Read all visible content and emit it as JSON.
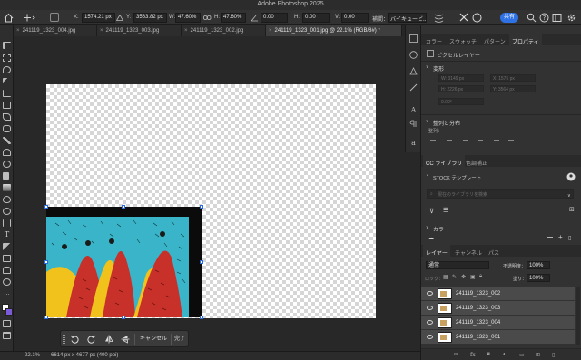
{
  "app": {
    "title": "Adobe Photoshop 2025"
  },
  "options_bar": {
    "x_label": "X:",
    "x_value": "1574.21 px",
    "y_label": "Y:",
    "y_value": "3563.82 px",
    "w_label": "W:",
    "w_value": "47.60%",
    "h_label": "H:",
    "h_value": "47.60%",
    "angle_value": "0.00",
    "h_skew_label": "H:",
    "h_skew_value": "0.00",
    "v_skew_label": "V:",
    "v_skew_value": "0.00",
    "interp_label": "補間：",
    "interp_value": "バイキュービ...",
    "share_label": "共有"
  },
  "tabs": [
    {
      "label": "241119_1323_004.jpg",
      "active": false
    },
    {
      "label": "241119_1323_003.jpg",
      "active": false
    },
    {
      "label": "241119_1323_002.jpg",
      "active": false
    },
    {
      "label": "241119_1323_001.jpg @ 22.1% (RGB/8#) *",
      "active": true
    }
  ],
  "tab_close_glyph": "×",
  "context_bar": {
    "cancel_label": "キャンセル",
    "done_label": "完了"
  },
  "status": {
    "zoom": "22.1%",
    "doc_size": "6614 px x 4677 px (400 ppi)"
  },
  "properties_panel": {
    "tabs": [
      "カラー",
      "スウォッチ",
      "パターン",
      "プロパティ"
    ],
    "active_tab": "プロパティ",
    "layer_type": "ピクセルレイヤー",
    "transform_heading": "変形",
    "transform_w": "W: 3149 px",
    "transform_x": "X: 1575 px",
    "transform_h": "H: 2226 px",
    "transform_y": "Y: 3564 px",
    "transform_angle": "0.00°",
    "align_heading": "整列と分布",
    "align_sub": "整列："
  },
  "cc_panel": {
    "tabs": [
      "CC ライブラリ",
      "色調補正"
    ],
    "active_tab": "CC ライブラリ",
    "stock_label": "STOCK テンプレート",
    "search_placeholder": "現在のライブラリを検索",
    "colors_heading": "カラー"
  },
  "layers_panel": {
    "tabs": [
      "レイヤー",
      "チャンネル",
      "パス"
    ],
    "active_tab": "レイヤー",
    "blend_mode": "通常",
    "opacity_label": "不透明度：",
    "opacity_value": "100%",
    "lock_label": "ロック：",
    "fill_label": "塗り：",
    "fill_value": "100%",
    "layers": [
      {
        "name": "241119_1323_002",
        "visible": true
      },
      {
        "name": "241119_1323_003",
        "visible": true
      },
      {
        "name": "241119_1323_004",
        "visible": true
      },
      {
        "name": "241119_1323_001",
        "visible": true
      }
    ]
  },
  "colors": {
    "accent": "#2f72e6",
    "artwork_sky": "#3ab4c8",
    "artwork_red": "#c8302a",
    "artwork_yellow": "#f2c21c",
    "foreground_swatch": "#ffffff",
    "background_swatch": "#7b5cd6"
  }
}
